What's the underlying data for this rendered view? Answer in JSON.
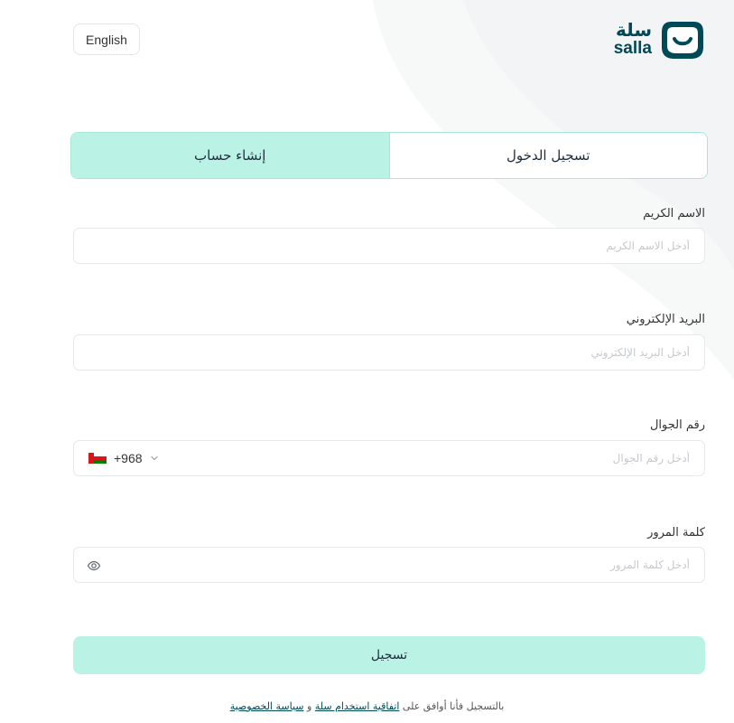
{
  "header": {
    "language_button": "English",
    "logo_ar": "سلة",
    "logo_en": "salla"
  },
  "tabs": {
    "login": "تسجيل الدخول",
    "register": "إنشاء حساب",
    "active": "register"
  },
  "form": {
    "name": {
      "label": "الاسم الكريم",
      "placeholder": "أدخل الاسم الكريم",
      "value": ""
    },
    "email": {
      "label": "البريد الإلكتروني",
      "placeholder": "أدخل البريد الإلكتروني",
      "value": ""
    },
    "phone": {
      "label": "رقم الجوال",
      "placeholder": "أدخل رقم الجوال",
      "country_code": "+968",
      "country": "Oman",
      "value": ""
    },
    "password": {
      "label": "كلمة المرور",
      "placeholder": "أدخل كلمة المرور",
      "value": ""
    },
    "submit_label": "تسجيل"
  },
  "terms": {
    "prefix": "بالتسجيل فأنا أوافق على",
    "agreement_link": "اتفاقية استخدام سلة",
    "conjunction": "و",
    "privacy_link": "سياسة الخصوصية"
  },
  "colors": {
    "brand": "#004956",
    "accent": "#baf3e6",
    "accent_border": "#a6e8d6"
  },
  "icons": {
    "chevron": "chevron-down-icon",
    "eye": "eye-icon",
    "flag": "oman-flag-icon"
  }
}
